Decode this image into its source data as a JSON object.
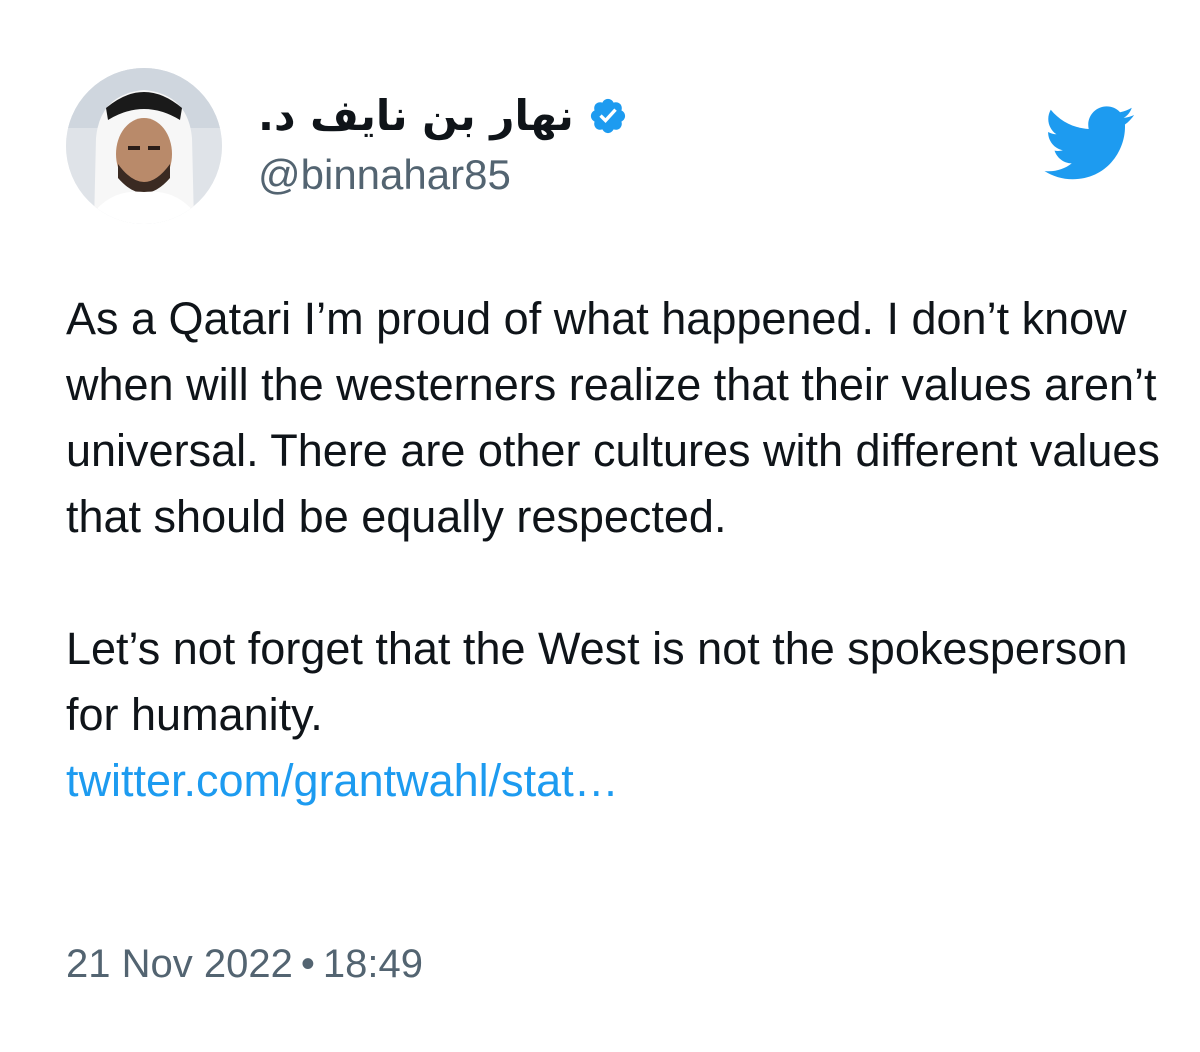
{
  "tweet": {
    "display_name": "نهار بن نايف د.",
    "handle": "@binnahar85",
    "verified": true,
    "paragraph1": "As a Qatari I’m proud of what happened. I don’t know when will the westerners realize that their values aren’t universal. There are other cultures with different values that should be equally respected.",
    "paragraph2": "Let’s not forget that the West is not the spokesperson for humanity.",
    "link_text": "twitter.com/grantwahl/stat…",
    "date": "21 Nov 2022",
    "separator": "•",
    "time": "18:49"
  },
  "icons": {
    "verified": "verified-badge-icon",
    "brand": "twitter-bird-icon",
    "avatar": "profile-avatar"
  },
  "colors": {
    "brand_blue": "#1d9bf0",
    "text": "#0f1419",
    "secondary_text": "#536471",
    "background": "#ffffff"
  }
}
